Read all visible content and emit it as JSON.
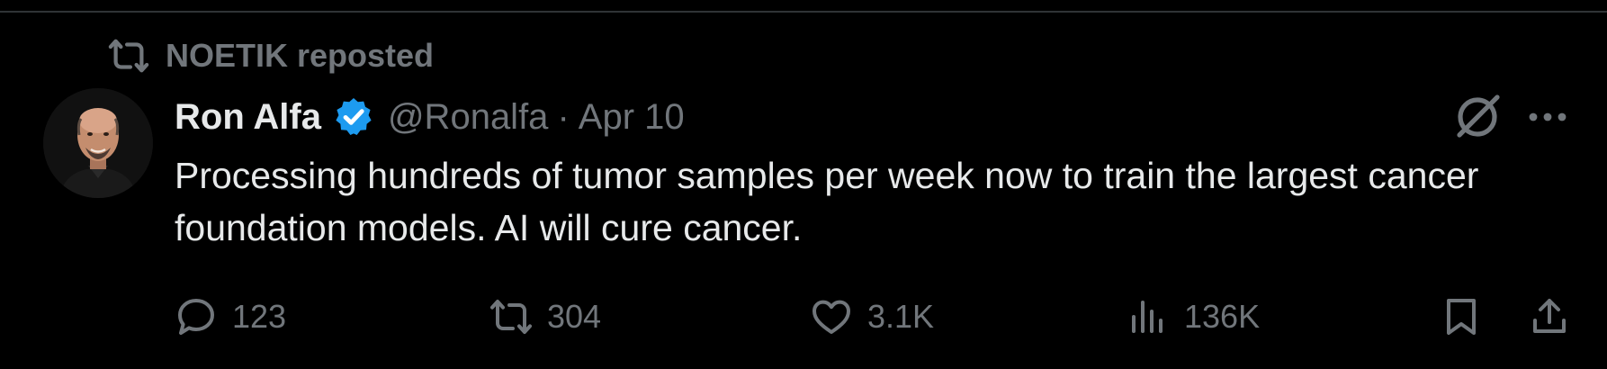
{
  "repost_banner": {
    "label": "NOETIK reposted",
    "icon": "repost-icon"
  },
  "tweet": {
    "author_name": "Ron Alfa",
    "handle": "@Ronalfa",
    "separator": "·",
    "date": "Apr 10",
    "text": "Processing hundreds of tumor samples per week now to train the largest cancer foundation models. AI will cure cancer."
  },
  "actions": {
    "reply_count": "123",
    "repost_count": "304",
    "like_count": "3.1K",
    "view_count": "136K"
  },
  "colors": {
    "background": "#000000",
    "text_primary": "#e7e9ea",
    "text_secondary": "#71767b",
    "verified_badge": "#1d9bf0"
  },
  "icons": [
    "repost-icon",
    "verified-badge-icon",
    "grok-icon",
    "more-icon",
    "reply-icon",
    "like-icon",
    "views-icon",
    "bookmark-icon",
    "share-icon"
  ]
}
